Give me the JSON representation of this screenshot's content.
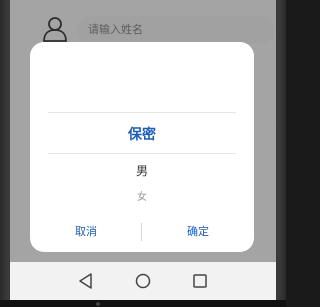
{
  "form": {
    "name_placeholder": "请输入姓名"
  },
  "picker": {
    "items": [
      "保密",
      "男",
      "女"
    ],
    "selected": "保密"
  },
  "dialog": {
    "cancel_label": "取消",
    "confirm_label": "确定"
  },
  "icons": {
    "user": "user-icon",
    "back": "back-triangle-icon",
    "home": "home-circle-icon",
    "recent": "recent-square-icon"
  },
  "colors": {
    "accent": "#1f5eb5"
  }
}
